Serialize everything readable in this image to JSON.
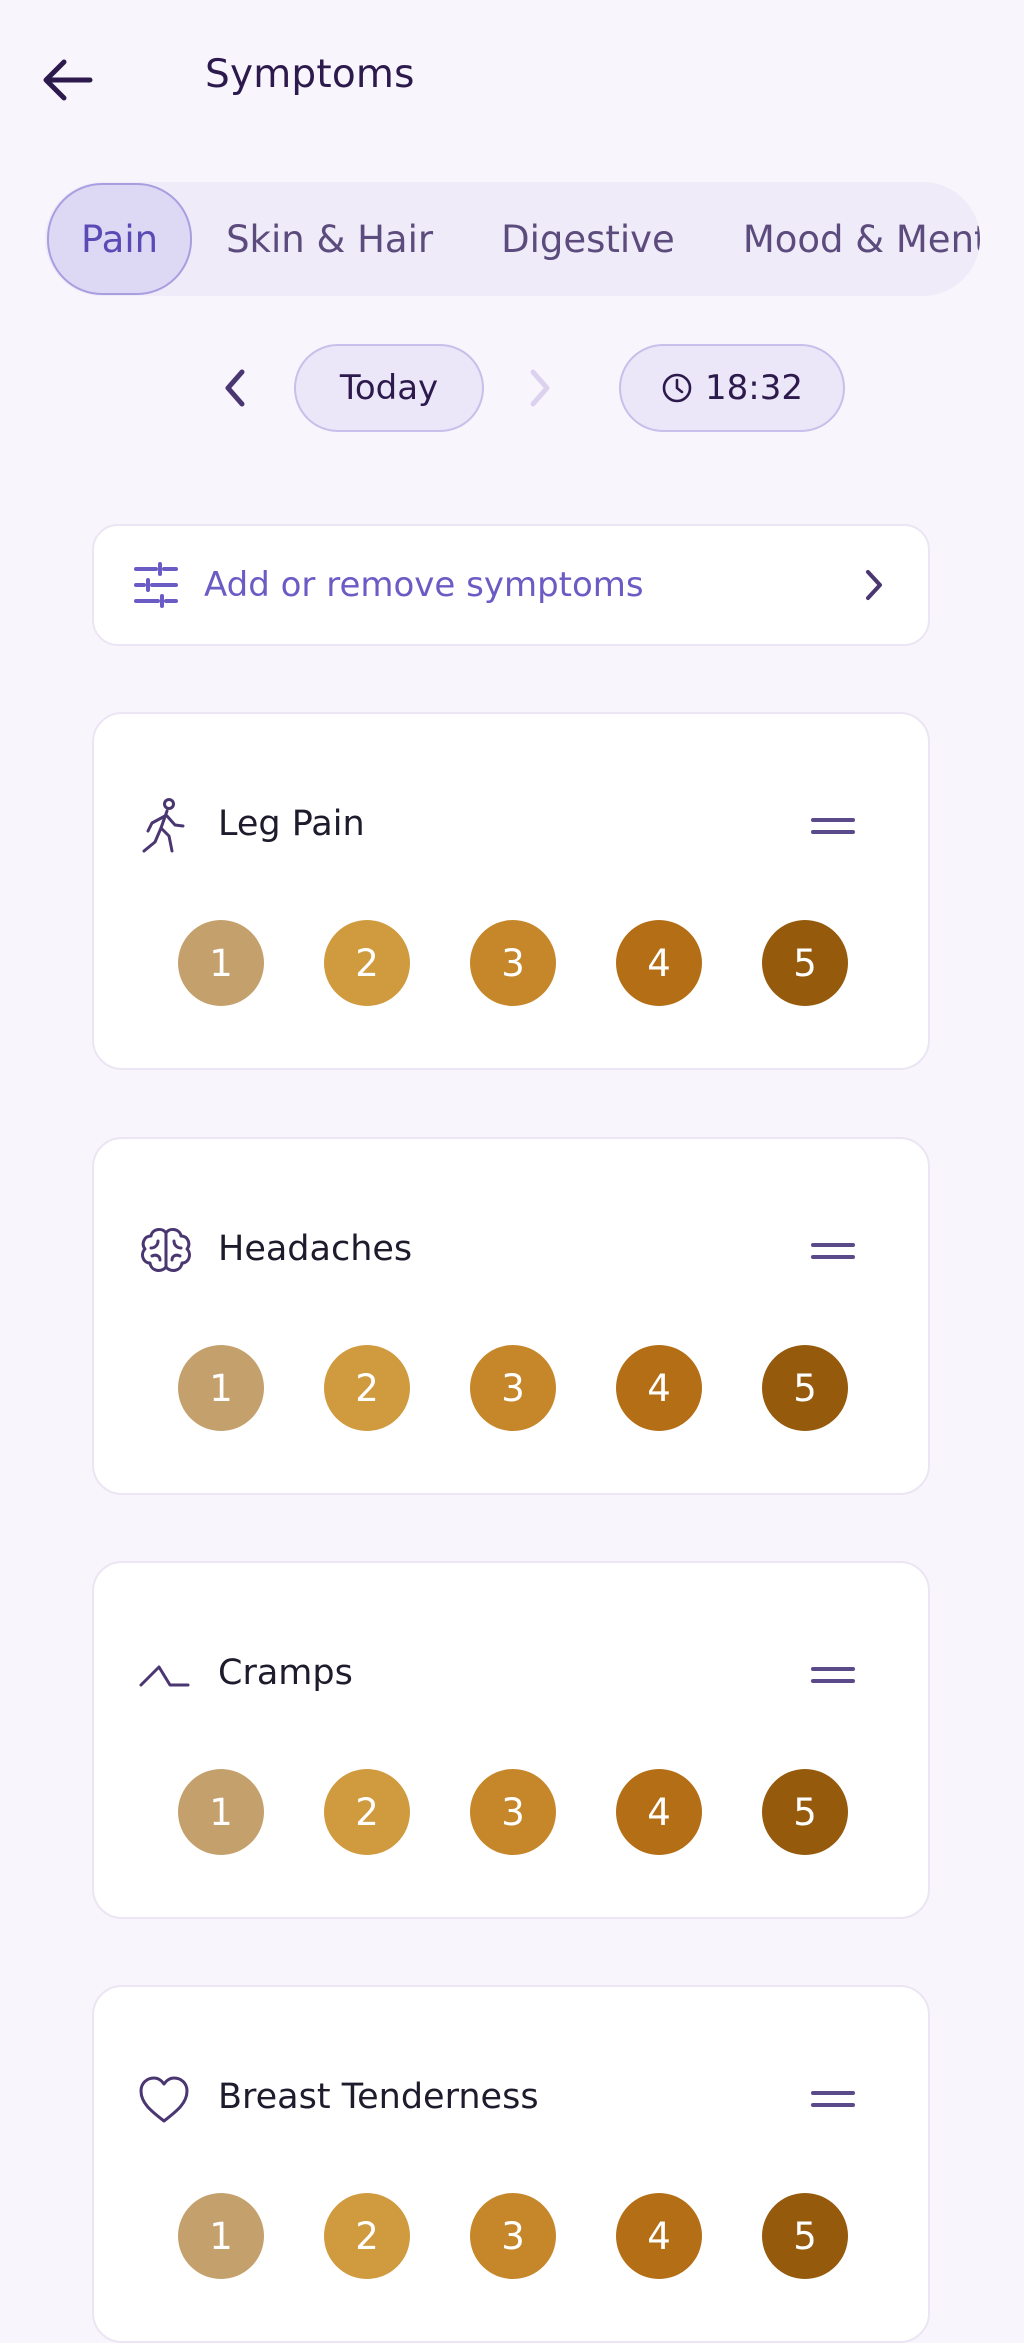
{
  "header": {
    "title": "Symptoms",
    "back_icon": "arrow-left-icon"
  },
  "tabs": [
    {
      "label": "Pain",
      "active": true
    },
    {
      "label": "Skin & Hair",
      "active": false
    },
    {
      "label": "Digestive",
      "active": false
    },
    {
      "label": "Mood & Mental",
      "active": false
    }
  ],
  "date_nav": {
    "date_label": "Today",
    "time_label": "18:32",
    "next_disabled": true
  },
  "manage": {
    "label": "Add or remove symptoms"
  },
  "rating_colors": [
    "#c4a06c",
    "#d09a3e",
    "#c6862a",
    "#b46e15",
    "#955a0c"
  ],
  "symptoms": [
    {
      "name": "Leg Pain",
      "icon": "walking-person-icon",
      "ratings": [
        "1",
        "2",
        "3",
        "4",
        "5"
      ]
    },
    {
      "name": "Headaches",
      "icon": "brain-icon",
      "ratings": [
        "1",
        "2",
        "3",
        "4",
        "5"
      ]
    },
    {
      "name": "Cramps",
      "icon": "zigzag-icon",
      "ratings": [
        "1",
        "2",
        "3",
        "4",
        "5"
      ]
    },
    {
      "name": "Breast Tenderness",
      "icon": "heart-icon",
      "ratings": [
        "1",
        "2",
        "3",
        "4",
        "5"
      ]
    }
  ]
}
